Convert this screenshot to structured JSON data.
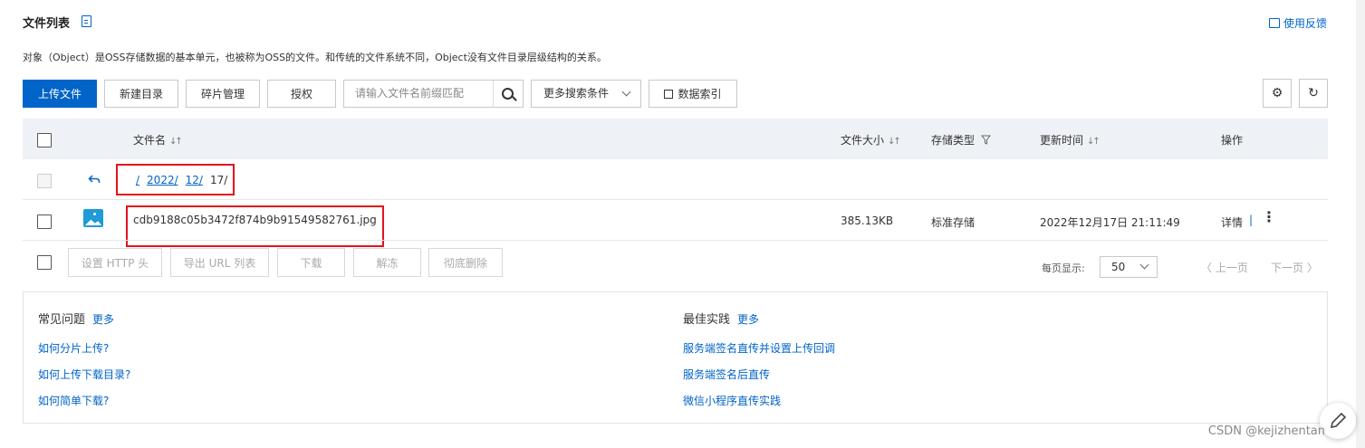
{
  "header": {
    "title": "文件列表",
    "feedback_label": "使用反馈",
    "description": "对象（Object）是OSS存储数据的基本单元，也被称为OSS的文件。和传统的文件系统不同，Object没有文件目录层级结构的关系。"
  },
  "toolbar": {
    "upload_label": "上传文件",
    "new_dir_label": "新建目录",
    "fragments_label": "碎片管理",
    "authorize_label": "授权",
    "search_placeholder": "请输入文件名前缀匹配",
    "more_conditions_label": "更多搜索条件",
    "data_index_label": "数据索引"
  },
  "table": {
    "headers": {
      "name": "文件名",
      "size": "文件大小",
      "storage": "存储类型",
      "updated": "更新时间",
      "actions": "操作"
    },
    "breadcrumb": {
      "root": "/",
      "year": "2022/",
      "month": "12/",
      "current": "17/"
    },
    "rows": [
      {
        "name": "cdb9188c05b3472f874b9b91549582761.jpg",
        "size": "385.13KB",
        "storage": "标准存储",
        "updated": "2022年12月17日 21:11:49",
        "detail_label": "详情"
      }
    ]
  },
  "bulk_actions": {
    "set_http_header": "设置 HTTP 头",
    "export_url_list": "导出 URL 列表",
    "download": "下载",
    "unfreeze": "解冻",
    "permanent_delete": "彻底删除"
  },
  "pagination": {
    "per_page_label": "每页显示:",
    "per_page_value": "50",
    "prev_label": "上一页",
    "next_label": "下一页"
  },
  "faq": {
    "faq_title": "常见问题",
    "faq_more": "更多",
    "faq_items": [
      "如何分片上传?",
      "如何上传下载目录?",
      "如何简单下载?"
    ],
    "best_title": "最佳实践",
    "best_more": "更多",
    "best_items": [
      "服务端签名直传并设置上传回调",
      "服务端签名后直传",
      "微信小程序直传实践"
    ]
  },
  "watermark": "CSDN @kejizhentan",
  "colors": {
    "primary": "#0064c8",
    "highlight_box": "#e3131b",
    "table_header_bg": "#eef1f5"
  }
}
